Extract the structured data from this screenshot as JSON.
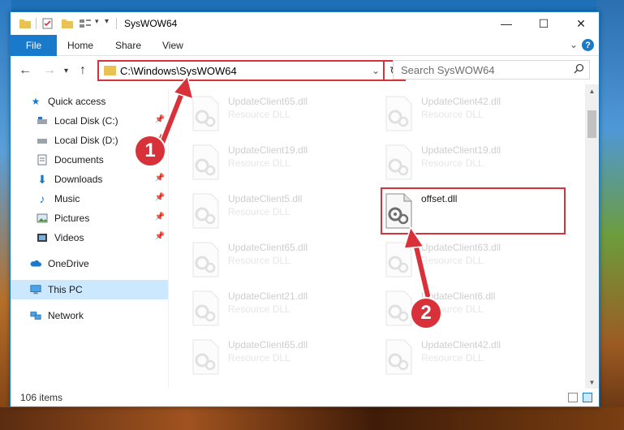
{
  "window": {
    "title": "SysWOW64",
    "controls": {
      "minimize": "—",
      "maximize": "☐",
      "close": "✕"
    }
  },
  "ribbon": {
    "tabs": [
      "File",
      "Home",
      "Share",
      "View"
    ],
    "help": "?"
  },
  "nav": {
    "address": "C:\\Windows\\SysWOW64",
    "search_placeholder": "Search SysWOW64"
  },
  "sidebar": {
    "items": [
      {
        "label": "Quick access",
        "icon": "star-icon"
      },
      {
        "label": "Local Disk (C:)",
        "icon": "drive-icon",
        "pinned": true
      },
      {
        "label": "Local Disk (D:)",
        "icon": "drive-icon",
        "pinned": true
      },
      {
        "label": "Documents",
        "icon": "documents-icon",
        "pinned": true
      },
      {
        "label": "Downloads",
        "icon": "download-icon",
        "pinned": true
      },
      {
        "label": "Music",
        "icon": "music-icon",
        "pinned": true
      },
      {
        "label": "Pictures",
        "icon": "pictures-icon",
        "pinned": true
      },
      {
        "label": "Videos",
        "icon": "videos-icon",
        "pinned": true
      },
      {
        "label": "OneDrive",
        "icon": "cloud-icon"
      },
      {
        "label": "This PC",
        "icon": "computer-icon",
        "selected": true
      },
      {
        "label": "Network",
        "icon": "network-icon"
      }
    ]
  },
  "files": [
    {
      "name": "UpdateClient65.dll",
      "type": "Resource DLL"
    },
    {
      "name": "UpdateClient42.dll",
      "type": "Resource DLL"
    },
    {
      "name": "UpdateClient19.dll",
      "type": "Resource DLL"
    },
    {
      "name": "UpdateClient19.dll",
      "type": "Resource DLL"
    },
    {
      "name": "UpdateClient5.dll",
      "type": "Resource DLL"
    },
    {
      "name": "offset.dll",
      "type": ""
    },
    {
      "name": "UpdateClient65.dll",
      "type": "Resource DLL"
    },
    {
      "name": "UpdateClient63.dll",
      "type": "Resource DLL"
    },
    {
      "name": "UpdateClient21.dll",
      "type": "Resource DLL"
    },
    {
      "name": "UpdateClient6.dll",
      "type": "Resource DLL"
    },
    {
      "name": "UpdateClient65.dll",
      "type": "Resource DLL"
    },
    {
      "name": "UpdateClient42.dll",
      "type": "Resource DLL"
    }
  ],
  "status": {
    "items": "106 items"
  },
  "callouts": {
    "one": "1",
    "two": "2"
  },
  "colors": {
    "accent": "#1979ca",
    "callout": "#d9313a",
    "selection": "#cce8ff"
  }
}
